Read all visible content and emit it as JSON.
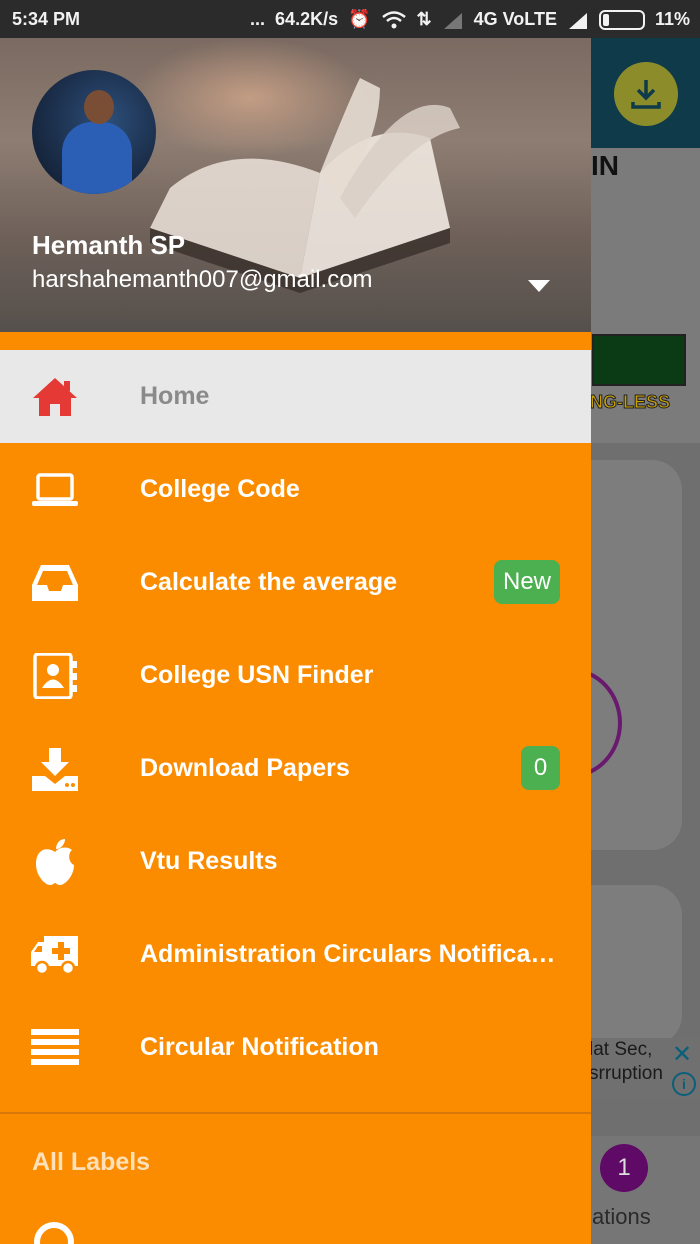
{
  "status_bar": {
    "time": "5:34 PM",
    "dots": "...",
    "net_speed": "64.2K/s",
    "network": "4G VoLTE",
    "battery": "11%"
  },
  "background_app": {
    "banner_text": "IN",
    "stamp_text": "NG-LESS",
    "ad_line1": "lat Sec,",
    "ad_line2": "srruption",
    "badge_count": "1",
    "tab_label": "ations"
  },
  "drawer": {
    "user": {
      "name": "Hemanth SP",
      "email": "harshahemanth007@gmail.com"
    },
    "menu": [
      {
        "label": "Home",
        "icon": "home-icon",
        "active": true
      },
      {
        "label": "College Code",
        "icon": "laptop-icon"
      },
      {
        "label": "Calculate the average",
        "icon": "inbox-icon",
        "badge": "New"
      },
      {
        "label": "College USN Finder",
        "icon": "contact-book-icon"
      },
      {
        "label": "Download Papers",
        "icon": "download-icon",
        "badge": "0"
      },
      {
        "label": "Vtu Results",
        "icon": "apple-icon"
      },
      {
        "label": "Administration Circulars Notifications",
        "icon": "ambulance-icon"
      },
      {
        "label": "Circular Notification",
        "icon": "list-icon"
      }
    ],
    "section_title": "All Labels"
  },
  "colors": {
    "accent": "#FB8C00",
    "badge": "#4CAF50",
    "home_icon": "#E53935",
    "active_bg": "#E8E8E8"
  }
}
